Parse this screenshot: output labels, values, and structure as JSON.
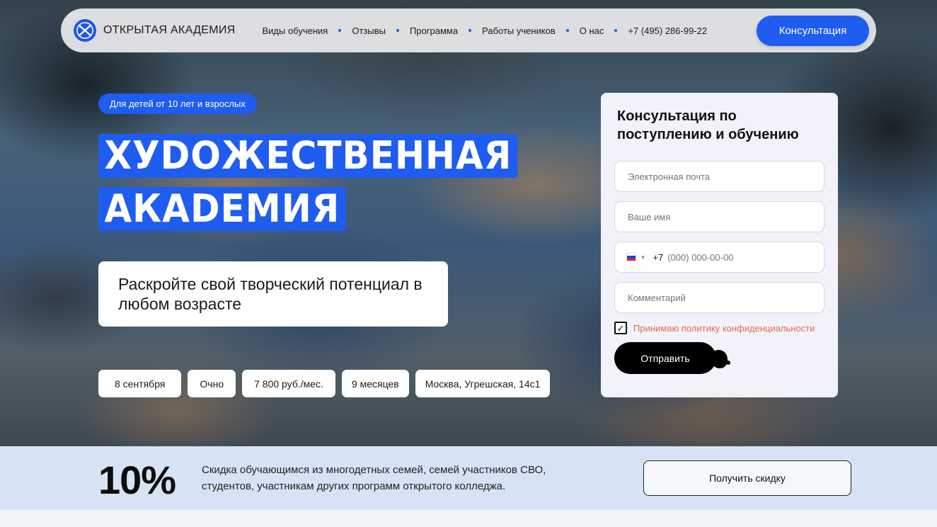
{
  "brand": {
    "name": "ОТКРЫТАЯ АКАДЕМИЯ",
    "logo_icon": "globe-logo-icon",
    "accent": "#1f5cf0"
  },
  "nav": {
    "items": [
      "Виды обучения",
      "Отзывы",
      "Программа",
      "Работы учеников",
      "О нас",
      "+7 (495) 286-99-22"
    ],
    "cta": "Консультация"
  },
  "hero": {
    "badge": "Для детей от 10 лет и взрослых",
    "headline": [
      "ХУDОЖЕСТВЕННАЯ",
      "АКАDЕМИЯ"
    ],
    "tagline": "Раскройте свой творческий потенциал в любом возрасте",
    "chips": [
      "8 сентября",
      "Очно",
      "7 800 руб./мес.",
      "9 месяцев",
      "Москва, Угрешская, 14с1"
    ]
  },
  "form": {
    "title": "Консультация по поступлению и обучению",
    "email_placeholder": "Электронная почта",
    "name_placeholder": "Ваше имя",
    "phone_code": "+7",
    "phone_placeholder": "(000) 000-00-00",
    "comment_placeholder": "Комментарий",
    "consent": "Принимаю политику конфиденциальности",
    "consent_checked": true,
    "submit": "Отправить"
  },
  "discount": {
    "value": "10%",
    "text": "Скидка обучающимся из многодетных семей, семей участников СВО, студентов, участникам других программ открытого колледжа.",
    "button": "Получить скидку"
  }
}
